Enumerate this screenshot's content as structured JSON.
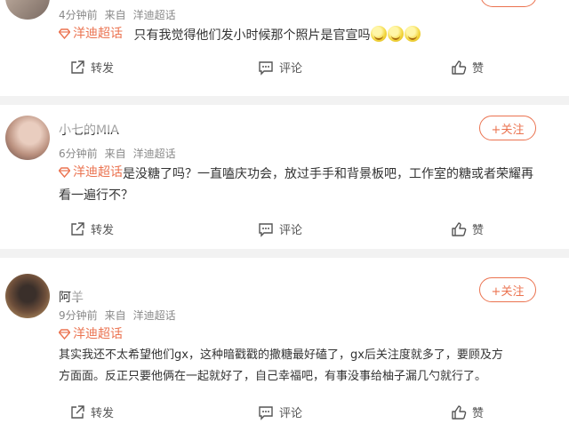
{
  "actions": {
    "share": "转发",
    "comment": "评论",
    "like": "赞"
  },
  "follow_label": "+关注",
  "posts": [
    {
      "meta": {
        "time": "4分钟前",
        "source": "来自",
        "from": "洋迪超话"
      },
      "topic": "洋迪超话",
      "text": "只有我觉得他们发小时候那个照片是官宣吗",
      "emoji_count": 3
    },
    {
      "username": "小七的MIA",
      "meta": {
        "time": "6分钟前",
        "source": "来自",
        "from": "洋迪超话"
      },
      "topic": "洋迪超话",
      "text_line1": "是没糖了吗？一直嗑庆功会，放过手手和背景板吧，工作室的糖或者荣耀再",
      "text_line2": "看一遍行不？"
    },
    {
      "username": "阿羊",
      "meta": {
        "time": "9分钟前",
        "source": "来自",
        "from": "洋迪超话"
      },
      "topic": "洋迪超话",
      "text_line1": "其实我还不太希望他们gx，这种暗戳戳的撒糖最好磕了，gx后关注度就多了，要顾及方",
      "text_line2": "方面面。反正只要他俩在一起就好了，自己幸福吧，有事没事给柚子漏几勺就行了。"
    }
  ]
}
